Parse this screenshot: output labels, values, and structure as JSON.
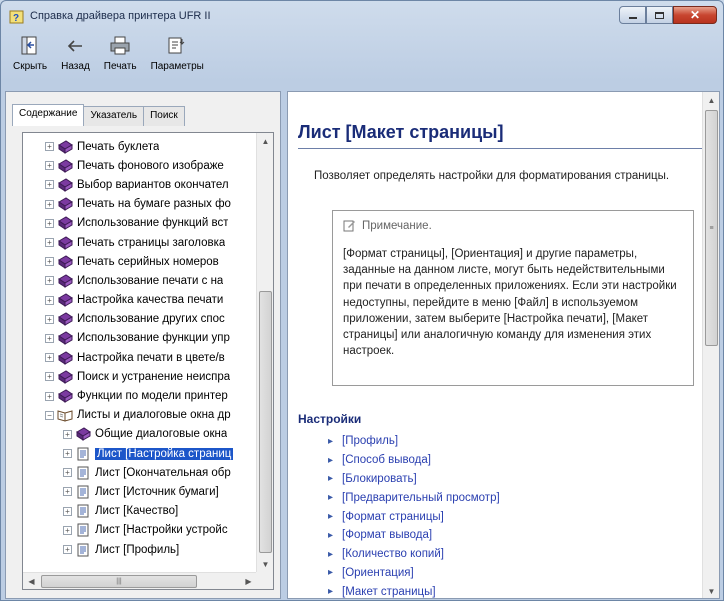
{
  "window": {
    "title": "Справка драйвера принтера UFR II"
  },
  "toolbar": {
    "hide": "Скрыть",
    "back": "Назад",
    "print": "Печать",
    "options": "Параметры"
  },
  "tabs": {
    "contents": "Содержание",
    "index": "Указатель",
    "search": "Поиск"
  },
  "tree": {
    "items": [
      {
        "label": "Печать буклета"
      },
      {
        "label": "Печать фонового изображе"
      },
      {
        "label": "Выбор вариантов окончател"
      },
      {
        "label": "Печать на бумаге разных фо"
      },
      {
        "label": "Использование функций вст"
      },
      {
        "label": "Печать страницы заголовка"
      },
      {
        "label": "Печать серийных номеров"
      },
      {
        "label": "Использование печати с на"
      },
      {
        "label": "Настройка качества печати"
      },
      {
        "label": "Использование других спос"
      },
      {
        "label": "Использование функции упр"
      },
      {
        "label": "Настройка печати в цвете/в"
      },
      {
        "label": "Поиск и устранение неиспра"
      },
      {
        "label": "Функции по модели принтер"
      },
      {
        "label": "Листы и диалоговые окна др"
      },
      {
        "label": "Общие диалоговые окна"
      },
      {
        "label": "Лист [Настройка страниц"
      },
      {
        "label": "Лист [Окончательная обр"
      },
      {
        "label": "Лист [Источник бумаги]"
      },
      {
        "label": "Лист [Качество]"
      },
      {
        "label": "Лист [Настройки устройс"
      },
      {
        "label": "Лист [Профиль]"
      }
    ]
  },
  "topic": {
    "title": "Лист [Макет страницы]",
    "intro": "Позволяет определять настройки для форматирования страницы.",
    "note_label": "Примечание.",
    "note_text": "[Формат страницы], [Ориентация] и другие параметры, заданные на данном листе, могут быть недействительными при печати в определенных приложениях. Если эти настройки недоступны, перейдите в меню [Файл] в используемом приложении, затем выберите [Настройка печати], [Макет страницы] или аналогичную команду для изменения этих настроек.",
    "settings_heading": "Настройки",
    "links": [
      "[Профиль]",
      "[Способ вывода]",
      "[Блокировать]",
      "[Предварительный просмотр]",
      "[Формат страницы]",
      "[Формат вывода]",
      "[Количество копий]",
      "[Ориентация]",
      "[Макет страницы]"
    ]
  }
}
